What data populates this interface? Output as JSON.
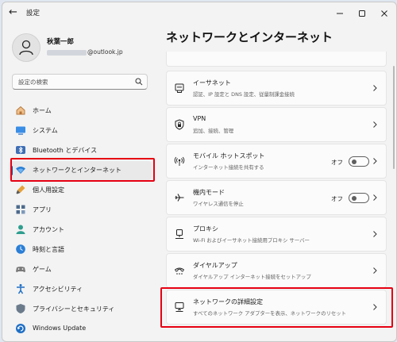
{
  "app": {
    "title": "設定"
  },
  "user": {
    "name": "秋葉一郎",
    "email_suffix": "@outlook.jp"
  },
  "search": {
    "placeholder": "設定の検索"
  },
  "nav": {
    "items": [
      {
        "label": "ホーム",
        "icon": "home-icon"
      },
      {
        "label": "システム",
        "icon": "system-icon"
      },
      {
        "label": "Bluetooth とデバイス",
        "icon": "bluetooth-icon"
      },
      {
        "label": "ネットワークとインターネット",
        "icon": "wifi-icon",
        "selected": true
      },
      {
        "label": "個人用設定",
        "icon": "brush-icon"
      },
      {
        "label": "アプリ",
        "icon": "apps-icon"
      },
      {
        "label": "アカウント",
        "icon": "account-icon"
      },
      {
        "label": "時刻と言語",
        "icon": "time-language-icon"
      },
      {
        "label": "ゲーム",
        "icon": "gamepad-icon"
      },
      {
        "label": "アクセシビリティ",
        "icon": "accessibility-icon"
      },
      {
        "label": "プライバシーとセキュリティ",
        "icon": "shield-icon"
      },
      {
        "label": "Windows Update",
        "icon": "update-icon"
      }
    ]
  },
  "main": {
    "heading": "ネットワークとインターネット",
    "cards": [
      {
        "title": "イーサネット",
        "desc": "認証、IP 設定と DNS 設定、従量制課金接続",
        "icon": "ethernet-icon"
      },
      {
        "title": "VPN",
        "desc": "追加、接続、管理",
        "icon": "vpn-icon"
      },
      {
        "title": "モバイル ホットスポット",
        "desc": "インターネット接続を共有する",
        "icon": "hotspot-icon",
        "toggle": "オフ",
        "toggle_on": false
      },
      {
        "title": "機内モード",
        "desc": "ワイヤレス通信を停止",
        "icon": "airplane-icon",
        "toggle": "オフ",
        "toggle_on": false
      },
      {
        "title": "プロキシ",
        "desc": "Wi-Fi およびイーサネット接続用プロキシ サーバー",
        "icon": "proxy-icon"
      },
      {
        "title": "ダイヤルアップ",
        "desc": "ダイヤルアップ インターネット接続をセットアップ",
        "icon": "dialup-icon"
      },
      {
        "title": "ネットワークの詳細設定",
        "desc": "すべてのネットワーク アダプターを表示、ネットワークのリセット",
        "icon": "network-adapter-icon"
      }
    ]
  },
  "colors": {
    "accent": "#005fb8",
    "highlight": "#e60012",
    "background": "#f3f3f3"
  }
}
